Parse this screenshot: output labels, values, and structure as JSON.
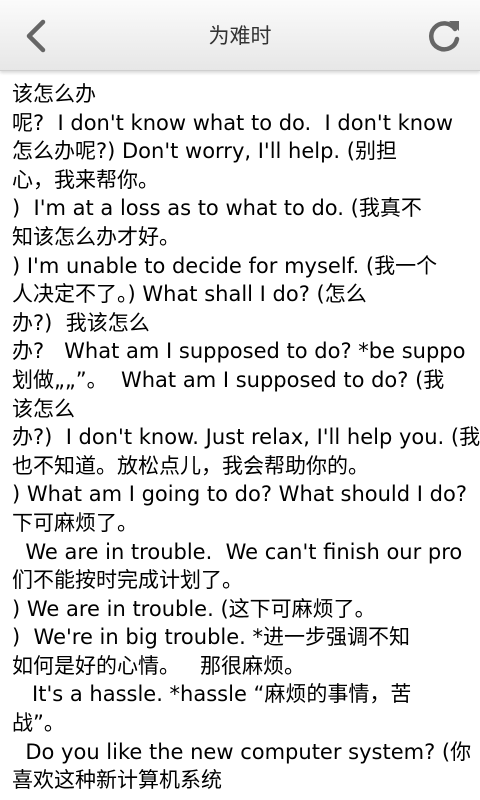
{
  "header": {
    "title": "为难时",
    "back_icon": "chevron-left-icon",
    "refresh_icon": "refresh-icon",
    "icon_color": "#666666"
  },
  "content": {
    "lines": [
      "该怎么办",
      "呢?  I don't know what to do.  I don't know",
      "怎么办呢?) Don't worry, I'll help. (别担",
      "心，我来帮你。",
      ")  I'm at a loss as to what to do. (我真不",
      "知该怎么办才好。",
      ") I'm unable to decide for myself. (我一个",
      "人决定不了。) What shall I do? (怎么",
      "办?)  我该怎么",
      "办?   What am I supposed to do? *be suppo",
      "划做„„”。  What am I supposed to do? (我",
      "该怎么",
      "办?)  I don't know. Just relax, I'll help you. (我",
      "也不知道。放松点儿，我会帮助你的。",
      ") What am I going to do? What should I do?",
      "下可麻烦了。",
      "  We are in trouble.  We can't finish our pro",
      "们不能按时完成计划了。",
      ") We are in trouble. (这下可麻烦了。",
      ")  We're in big trouble. *进一步强调不知",
      "如何是好的心情。   那很麻烦。",
      "   It's a hassle. *hassle “麻烦的事情，苦",
      "战”。",
      "  Do you like the new computer system? (你",
      "喜欢这种新计算机系统"
    ]
  }
}
